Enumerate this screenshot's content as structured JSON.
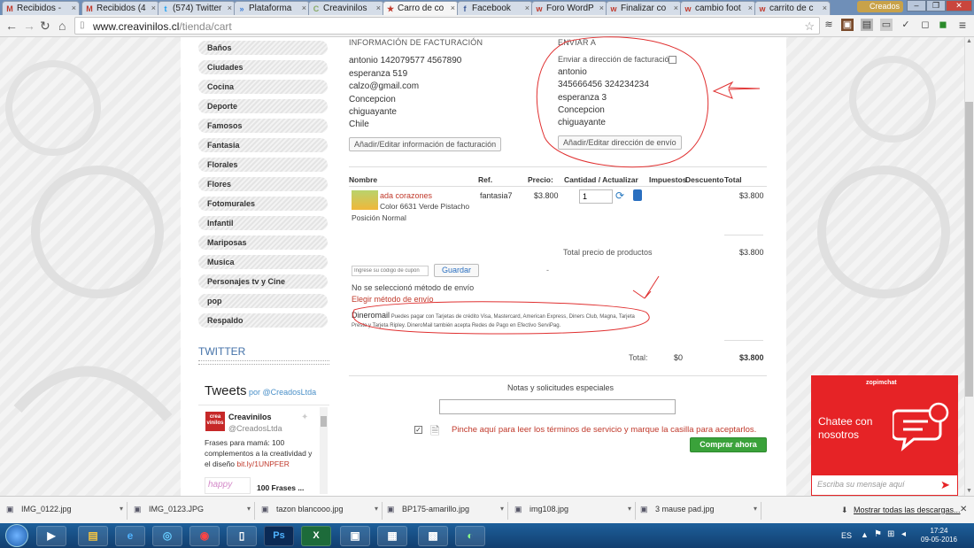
{
  "browser": {
    "tabs": [
      {
        "label": "Recibidos -",
        "icon": "M",
        "active": false
      },
      {
        "label": "Recibidos (4",
        "icon": "M",
        "active": false
      },
      {
        "label": "(574) Twitter",
        "icon": "t",
        "active": false
      },
      {
        "label": "Plataforma",
        "icon": "»",
        "active": false
      },
      {
        "label": "Creavinilos",
        "icon": "C",
        "active": false
      },
      {
        "label": "Carro de co",
        "icon": "★",
        "active": true
      },
      {
        "label": "Facebook",
        "icon": "f",
        "active": false
      },
      {
        "label": "Foro WordP",
        "icon": "w",
        "active": false
      },
      {
        "label": "Finalizar co",
        "icon": "w",
        "active": false
      },
      {
        "label": "cambio foot",
        "icon": "w",
        "active": false
      },
      {
        "label": "carrito de c",
        "icon": "w",
        "active": false
      }
    ],
    "profile": "Creados",
    "url_host": "www.creavinilos.cl",
    "url_path": "/tienda/cart"
  },
  "sidebar": {
    "categories": [
      "Baños",
      "Ciudades",
      "Cocina",
      "Deporte",
      "Famosos",
      "Fantasia",
      "Florales",
      "Flores",
      "Fotomurales",
      "Infantil",
      "Mariposas",
      "Musica",
      "Personajes tv y Cine",
      "pop",
      "Respaldo"
    ],
    "twitter_heading": "TWITTER",
    "tweets_title": "Tweets",
    "tweets_by": "por @CreadosLtda",
    "tweet": {
      "avatar_text": "crea vinilos",
      "name": "Creavinilos",
      "handle": "@CreadosLtda",
      "text": "Frases para mamá: 100 complementos a la creatividad y el diseño",
      "link": "bit.ly/1UNPFER",
      "card_title": "100 Frases ...",
      "card_image_text": "happy"
    }
  },
  "billing": {
    "heading": "INFORMACIÓN DE FACTURACIÓN",
    "lines": [
      "antonio 142079577 4567890",
      "esperanza 519",
      "calzo@gmail.com",
      "Concepcion",
      "chiguayante",
      "Chile"
    ],
    "button": "Añadir/Editar información de facturación"
  },
  "shipping": {
    "heading": "ENVIAR A",
    "checkbox_label": "Enviar a dirección de facturación",
    "lines": [
      "antonio",
      "345666456 324234234",
      "esperanza 3",
      "Concepcion",
      "chiguayante"
    ],
    "button": "Añadir/Editar dirección de envío"
  },
  "cart": {
    "headers": {
      "name": "Nombre",
      "ref": "Ref.",
      "price": "Precio:",
      "qty": "Cantidad / Actualizar",
      "tax": "Impuestos",
      "discount": "Descuento",
      "total": "Total"
    },
    "item": {
      "name": "ada corazones",
      "desc1": "Color 6631 Verde Pistacho",
      "desc2": "Posición Normal",
      "ref": "fantasia7",
      "price": "$3.800",
      "qty": "1",
      "total": "$3.800"
    },
    "products_total_label": "Total precio de productos",
    "products_total": "$3.800",
    "coupon_placeholder": "Ingrese su código de cupón",
    "coupon_button": "Guardar",
    "dash": "-",
    "no_shipping": "No se seleccionó método de envío",
    "choose_shipping": "Elegir método de envío",
    "payment_name": "Dineromail",
    "payment_desc": "Puedes pagar con Tarjetas de crédito Visa, Mastercard, American Express, Diners Club, Magna, Tarjeta Presto y Tarjeta Ripley. DineroMail también acepta Redes de Pago en Efectivo ServiPag.",
    "total_label": "Total:",
    "total_tax": "$0",
    "total": "$3.800",
    "notes_label": "Notas y solicitudes especiales",
    "tos_text": "Pinche aquí para leer los términos de servicio y marque la casilla para aceptarlos.",
    "buy_button": "Comprar ahora"
  },
  "chat": {
    "brand": "zopimchat",
    "title": "Chatee con nosotros",
    "input_placeholder": "Escriba su mensaje aquí"
  },
  "downloads": {
    "items": [
      "IMG_0122.jpg",
      "IMG_0123.JPG",
      "tazon blancooo.jpg",
      "BP175-amarillo.jpg",
      "img108.jpg",
      "3 mause pad.jpg"
    ],
    "show_all": "Mostrar todas las descargas..."
  },
  "taskbar": {
    "apps": [
      "media-player",
      "file-explorer",
      "internet-explorer",
      "firefox",
      "chrome",
      "device",
      "photoshop",
      "excel",
      "app",
      "calculator",
      "app2",
      "app3"
    ],
    "language": "ES",
    "time": "17:24",
    "date": "09-05-2016"
  },
  "colors": {
    "accent_red": "#c0392b",
    "buy_green": "#3aa23a",
    "chat_red": "#e62326",
    "annotation_red": "#e03030"
  }
}
